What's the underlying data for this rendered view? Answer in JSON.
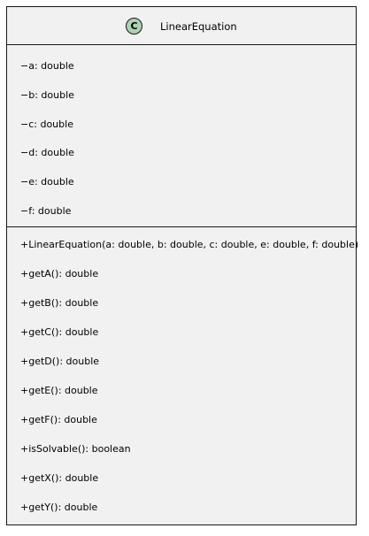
{
  "class": {
    "stereotype_letter": "C",
    "name": "LinearEquation",
    "icon_color": "#add1b2",
    "fields": [
      "−a: double",
      "−b: double",
      "−c: double",
      "−d: double",
      "−e: double",
      "−f: double"
    ],
    "methods": [
      "+LinearEquation(a: double, b: double, c: double, e: double, f: double)",
      "+getA(): double",
      "+getB(): double",
      "+getC(): double",
      "+getD(): double",
      "+getE(): double",
      "+getF(): double",
      "+isSolvable(): boolean",
      "+getX(): double",
      "+getY(): double"
    ]
  }
}
